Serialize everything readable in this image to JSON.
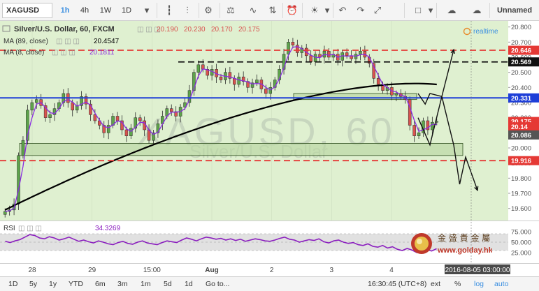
{
  "toolbar": {
    "symbol": "XAGUSD",
    "intervals": [
      "1h",
      "4h",
      "1W",
      "1D"
    ],
    "active_interval": "1h",
    "layout_name": "Unnamed"
  },
  "legend": {
    "title": "Silver/U.S. Dollar, 60, FXCM",
    "ohlc": [
      "20.190",
      "20.230",
      "20.170",
      "20.175"
    ],
    "ma1_label": "MA (89, close)",
    "ma1_value": "20.4547",
    "ma2_label": "MA (8, close)",
    "ma2_value": "20.1811",
    "realtime": "realtime"
  },
  "watermark": {
    "symbol": "XAGUSD, 60",
    "name": "Silver/U.S. Dollar"
  },
  "rsi_legend": {
    "label": "RSI",
    "value": "34.3269"
  },
  "price_axis": {
    "ticks": [
      "20.800",
      "20.700",
      "20.600",
      "20.500",
      "20.400",
      "20.300",
      "20.200",
      "20.100",
      "20.000",
      "19.900",
      "19.800",
      "19.700",
      "19.600"
    ],
    "tags": [
      {
        "value": "20.646",
        "color": "#e53935"
      },
      {
        "value": "20.569",
        "color": "#111111"
      },
      {
        "value": "20.331",
        "color": "#1e3fd8"
      },
      {
        "value": "20.175",
        "color": "#e53935"
      },
      {
        "value": "20.14",
        "color": "#e53935"
      },
      {
        "value": "20.086",
        "color": "#555555"
      },
      {
        "value": "19.916",
        "color": "#e53935"
      }
    ]
  },
  "rsi_axis": {
    "ticks": [
      "75.000",
      "50.000",
      "25.000"
    ]
  },
  "time_axis": {
    "labels": [
      "28",
      "29",
      "15:00",
      "Aug",
      "2",
      "3",
      "4"
    ],
    "cursor_label": "2016-08-05 03:00:00"
  },
  "bottom_bar": {
    "ranges": [
      "1D",
      "5y",
      "1y",
      "YTD",
      "6m",
      "3m",
      "1m",
      "5d",
      "1d"
    ],
    "goto": "Go to...",
    "clock": "16:30:45 (UTC+8)",
    "options": [
      "ext",
      "%",
      "log",
      "auto"
    ]
  },
  "brand": {
    "name": "金 盛 貴 金 屬",
    "url": "www.golday.hk"
  },
  "colors": {
    "background": "#dff0d0",
    "candle_up": "#5da44a",
    "candle_down": "#d9534f",
    "ma89": "#000000",
    "ma8": "#8a2be2",
    "resistance_red": "#e53935",
    "support_blue": "#1e3fd8",
    "rsi_line": "#8b1fbf",
    "rsi_band": "#c8c8c8"
  },
  "chart_data": {
    "type": "candlestick",
    "title": "Silver/U.S. Dollar, 60, FXCM",
    "ylim": [
      19.52,
      20.84
    ],
    "closes": [
      19.58,
      19.59,
      19.63,
      19.95,
      20.05,
      20.25,
      20.3,
      20.32,
      20.28,
      20.2,
      20.22,
      20.26,
      20.3,
      20.36,
      20.3,
      20.25,
      20.28,
      20.34,
      20.29,
      20.22,
      20.18,
      20.15,
      20.1,
      20.15,
      20.21,
      20.18,
      20.12,
      20.08,
      20.13,
      20.2,
      20.18,
      20.12,
      20.05,
      20.1,
      20.16,
      20.21,
      20.26,
      20.24,
      20.21,
      20.27,
      20.3,
      20.38,
      20.5,
      20.55,
      20.52,
      20.48,
      20.52,
      20.47,
      20.45,
      20.5,
      20.46,
      20.42,
      20.47,
      20.44,
      20.4,
      20.43,
      20.45,
      20.39,
      20.36,
      20.4,
      20.45,
      20.52,
      20.62,
      20.7,
      20.68,
      20.63,
      20.66,
      20.61,
      20.57,
      20.62,
      20.6,
      20.64,
      20.6,
      20.62,
      20.58,
      20.63,
      20.61,
      20.59,
      20.62,
      20.64,
      20.6,
      20.56,
      20.46,
      20.42,
      20.38,
      20.4,
      20.35,
      20.36,
      20.34,
      20.32,
      20.15,
      20.08,
      20.1,
      20.18,
      20.12,
      20.17,
      20.175
    ],
    "levels": [
      {
        "value": 20.646,
        "style": "dashed",
        "color": "#e53935"
      },
      {
        "value": 20.569,
        "style": "dashed",
        "color": "#111111"
      },
      {
        "value": 20.331,
        "style": "solid",
        "color": "#1e3fd8"
      },
      {
        "value": 19.916,
        "style": "dashed",
        "color": "#e53935"
      }
    ],
    "zones": [
      {
        "from": 19.95,
        "to": 20.03
      },
      {
        "from": 20.32,
        "to": 20.36
      }
    ],
    "forecast_paths": [
      [
        [
          0,
          20.36
        ],
        [
          0.6,
          20.29
        ],
        [
          1,
          20.36
        ],
        [
          2,
          20.34
        ],
        [
          3,
          20.65
        ]
      ],
      [
        [
          0,
          20.2
        ],
        [
          1,
          20.02
        ],
        [
          2,
          20.34
        ],
        [
          3,
          20.02
        ],
        [
          3.5,
          19.76
        ],
        [
          4,
          19.94
        ],
        [
          5,
          19.72
        ]
      ]
    ],
    "rsi": {
      "ylim": [
        0,
        100
      ],
      "values": [
        52,
        49,
        53,
        56,
        62,
        68,
        66,
        60,
        58,
        63,
        60,
        55,
        58,
        62,
        57,
        52,
        55,
        51,
        48,
        53,
        50,
        46,
        44,
        49,
        52,
        47,
        45,
        50,
        53,
        48,
        46,
        44,
        49,
        53,
        51,
        49,
        55,
        60,
        57,
        53,
        58,
        62,
        60,
        57,
        59,
        55,
        58,
        54,
        57,
        52,
        55,
        58,
        56,
        53,
        52,
        55,
        59,
        62,
        57,
        55,
        50,
        53,
        56,
        54,
        58,
        51,
        48,
        53,
        55,
        50,
        47,
        49,
        44,
        42,
        46,
        40,
        38,
        42,
        36,
        39,
        33,
        30,
        35,
        31,
        25,
        28,
        32,
        29,
        34.3
      ]
    }
  }
}
